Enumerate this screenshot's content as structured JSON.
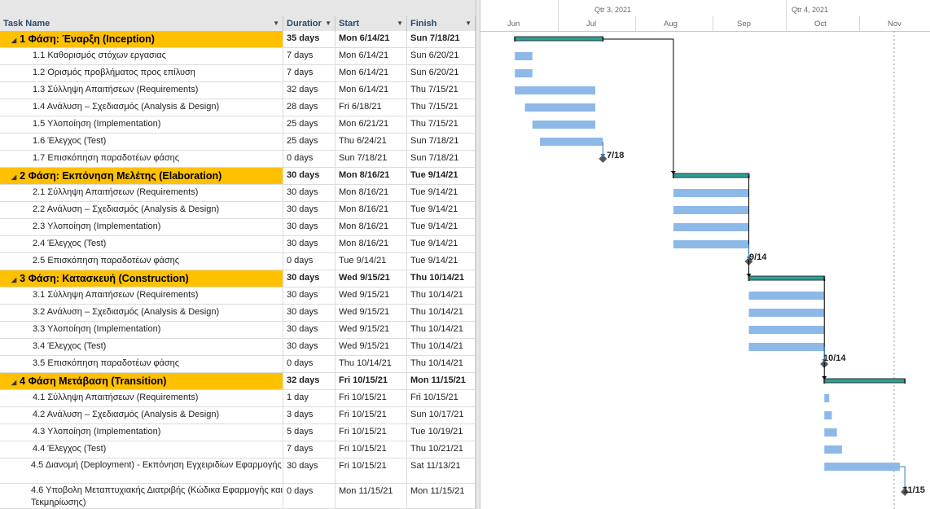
{
  "columns": {
    "task_name": "Task Name",
    "duration": "Duratior",
    "start": "Start",
    "finish": "Finish"
  },
  "timescale": {
    "quarters": [
      "Qtr 3, 2021",
      "Qtr 4, 2021"
    ],
    "months": [
      "Jun",
      "Jul",
      "Aug",
      "Sep",
      "Oct",
      "Nov"
    ]
  },
  "colors": {
    "summary_row": "#ffc000",
    "summary_bar": "#2aa198",
    "task_bar": "#8db9e8",
    "link": "#2e75b6"
  },
  "rows": [
    {
      "name": "1 Φάση: Έναρξη (Inception)",
      "duration": "35 days",
      "start": "Mon 6/14/21",
      "finish": "Sun 7/18/21",
      "summary": true
    },
    {
      "name": "1.1 Καθορισμός στόχων εργασιας",
      "duration": "7 days",
      "start": "Mon 6/14/21",
      "finish": "Sun 6/20/21"
    },
    {
      "name": "1.2 Ορισμός προβλήματος προς επίλυση",
      "duration": "7 days",
      "start": "Mon 6/14/21",
      "finish": "Sun 6/20/21"
    },
    {
      "name": "1.3 Σύλληψη Απαιτήσεων (Requirements)",
      "duration": "32 days",
      "start": "Mon 6/14/21",
      "finish": "Thu 7/15/21"
    },
    {
      "name": "1.4 Ανάλυση – Σχεδιασμός (Analysis & Design)",
      "duration": "28 days",
      "start": "Fri 6/18/21",
      "finish": "Thu 7/15/21"
    },
    {
      "name": "1.5 Υλοποίηση (Implementation)",
      "duration": "25 days",
      "start": "Mon 6/21/21",
      "finish": "Thu 7/15/21"
    },
    {
      "name": "1.6 Έλεγχος (Test)",
      "duration": "25 days",
      "start": "Thu 6/24/21",
      "finish": "Sun 7/18/21"
    },
    {
      "name": "1.7 Επισκόπηση παραδοτέων φάσης",
      "duration": "0 days",
      "start": "Sun 7/18/21",
      "finish": "Sun 7/18/21"
    },
    {
      "name": "2 Φάση: Εκπόνηση Μελέτης (Elaboration)",
      "duration": "30 days",
      "start": "Mon 8/16/21",
      "finish": "Tue 9/14/21",
      "summary": true
    },
    {
      "name": "2.1 Σύλληψη Απαιτήσεων (Requirements)",
      "duration": "30 days",
      "start": "Mon 8/16/21",
      "finish": "Tue 9/14/21"
    },
    {
      "name": "2.2 Ανάλυση – Σχεδιασμός (Analysis & Design)",
      "duration": "30 days",
      "start": "Mon 8/16/21",
      "finish": "Tue 9/14/21"
    },
    {
      "name": "2.3 Υλοποίηση (Implementation)",
      "duration": "30 days",
      "start": "Mon 8/16/21",
      "finish": "Tue 9/14/21"
    },
    {
      "name": "2.4 Έλεγχος (Test)",
      "duration": "30 days",
      "start": "Mon 8/16/21",
      "finish": "Tue 9/14/21"
    },
    {
      "name": "2.5 Επισκόπηση παραδοτέων φάσης",
      "duration": "0 days",
      "start": "Tue 9/14/21",
      "finish": "Tue 9/14/21"
    },
    {
      "name": "3 Φάση: Κατασκευή (Construction)",
      "duration": "30 days",
      "start": "Wed 9/15/21",
      "finish": "Thu 10/14/21",
      "summary": true
    },
    {
      "name": "3.1 Σύλληψη Απαιτήσεων (Requirements)",
      "duration": "30 days",
      "start": "Wed 9/15/21",
      "finish": "Thu 10/14/21"
    },
    {
      "name": "3.2 Ανάλυση – Σχεδιασμός (Analysis & Design)",
      "duration": "30 days",
      "start": "Wed 9/15/21",
      "finish": "Thu 10/14/21"
    },
    {
      "name": "3.3 Υλοποίηση (Implementation)",
      "duration": "30 days",
      "start": "Wed 9/15/21",
      "finish": "Thu 10/14/21"
    },
    {
      "name": "3.4 Έλεγχος (Test)",
      "duration": "30 days",
      "start": "Wed 9/15/21",
      "finish": "Thu 10/14/21"
    },
    {
      "name": "3.5 Επισκόπηση παραδοτέων φάσης",
      "duration": "0 days",
      "start": "Thu 10/14/21",
      "finish": "Thu 10/14/21"
    },
    {
      "name": "4 Φάση Μετάβαση (Transition)",
      "duration": "32 days",
      "start": "Fri 10/15/21",
      "finish": "Mon 11/15/21",
      "summary": true
    },
    {
      "name": "4.1 Σύλληψη Απαιτήσεων (Requirements)",
      "duration": "1 day",
      "start": "Fri 10/15/21",
      "finish": "Fri 10/15/21"
    },
    {
      "name": "4.2 Ανάλυση – Σχεδιασμός (Analysis & Design)",
      "duration": "3 days",
      "start": "Fri 10/15/21",
      "finish": "Sun 10/17/21"
    },
    {
      "name": "4.3 Υλοποίηση (Implementation)",
      "duration": "5 days",
      "start": "Fri 10/15/21",
      "finish": "Tue 10/19/21"
    },
    {
      "name": "4.4 Έλεγχος (Test)",
      "duration": "7 days",
      "start": "Fri 10/15/21",
      "finish": "Thu 10/21/21"
    },
    {
      "name": "4.5 Διανομή (Deployment) - Εκπόνηση Εγχειριδίων Εφαρμογής",
      "duration": "30 days",
      "start": "Fri 10/15/21",
      "finish": "Sat 11/13/21"
    },
    {
      "name": "4.6 Υποβολη Μεταπτυχιακής Διατριβής (Κώδικα Εφαρμογής και Τεκμηρίωσης)",
      "duration": "0 days",
      "start": "Mon 11/15/21",
      "finish": "Mon 11/15/21"
    }
  ],
  "milestone_labels": [
    "7/18",
    "9/14",
    "10/14",
    "11/15"
  ]
}
